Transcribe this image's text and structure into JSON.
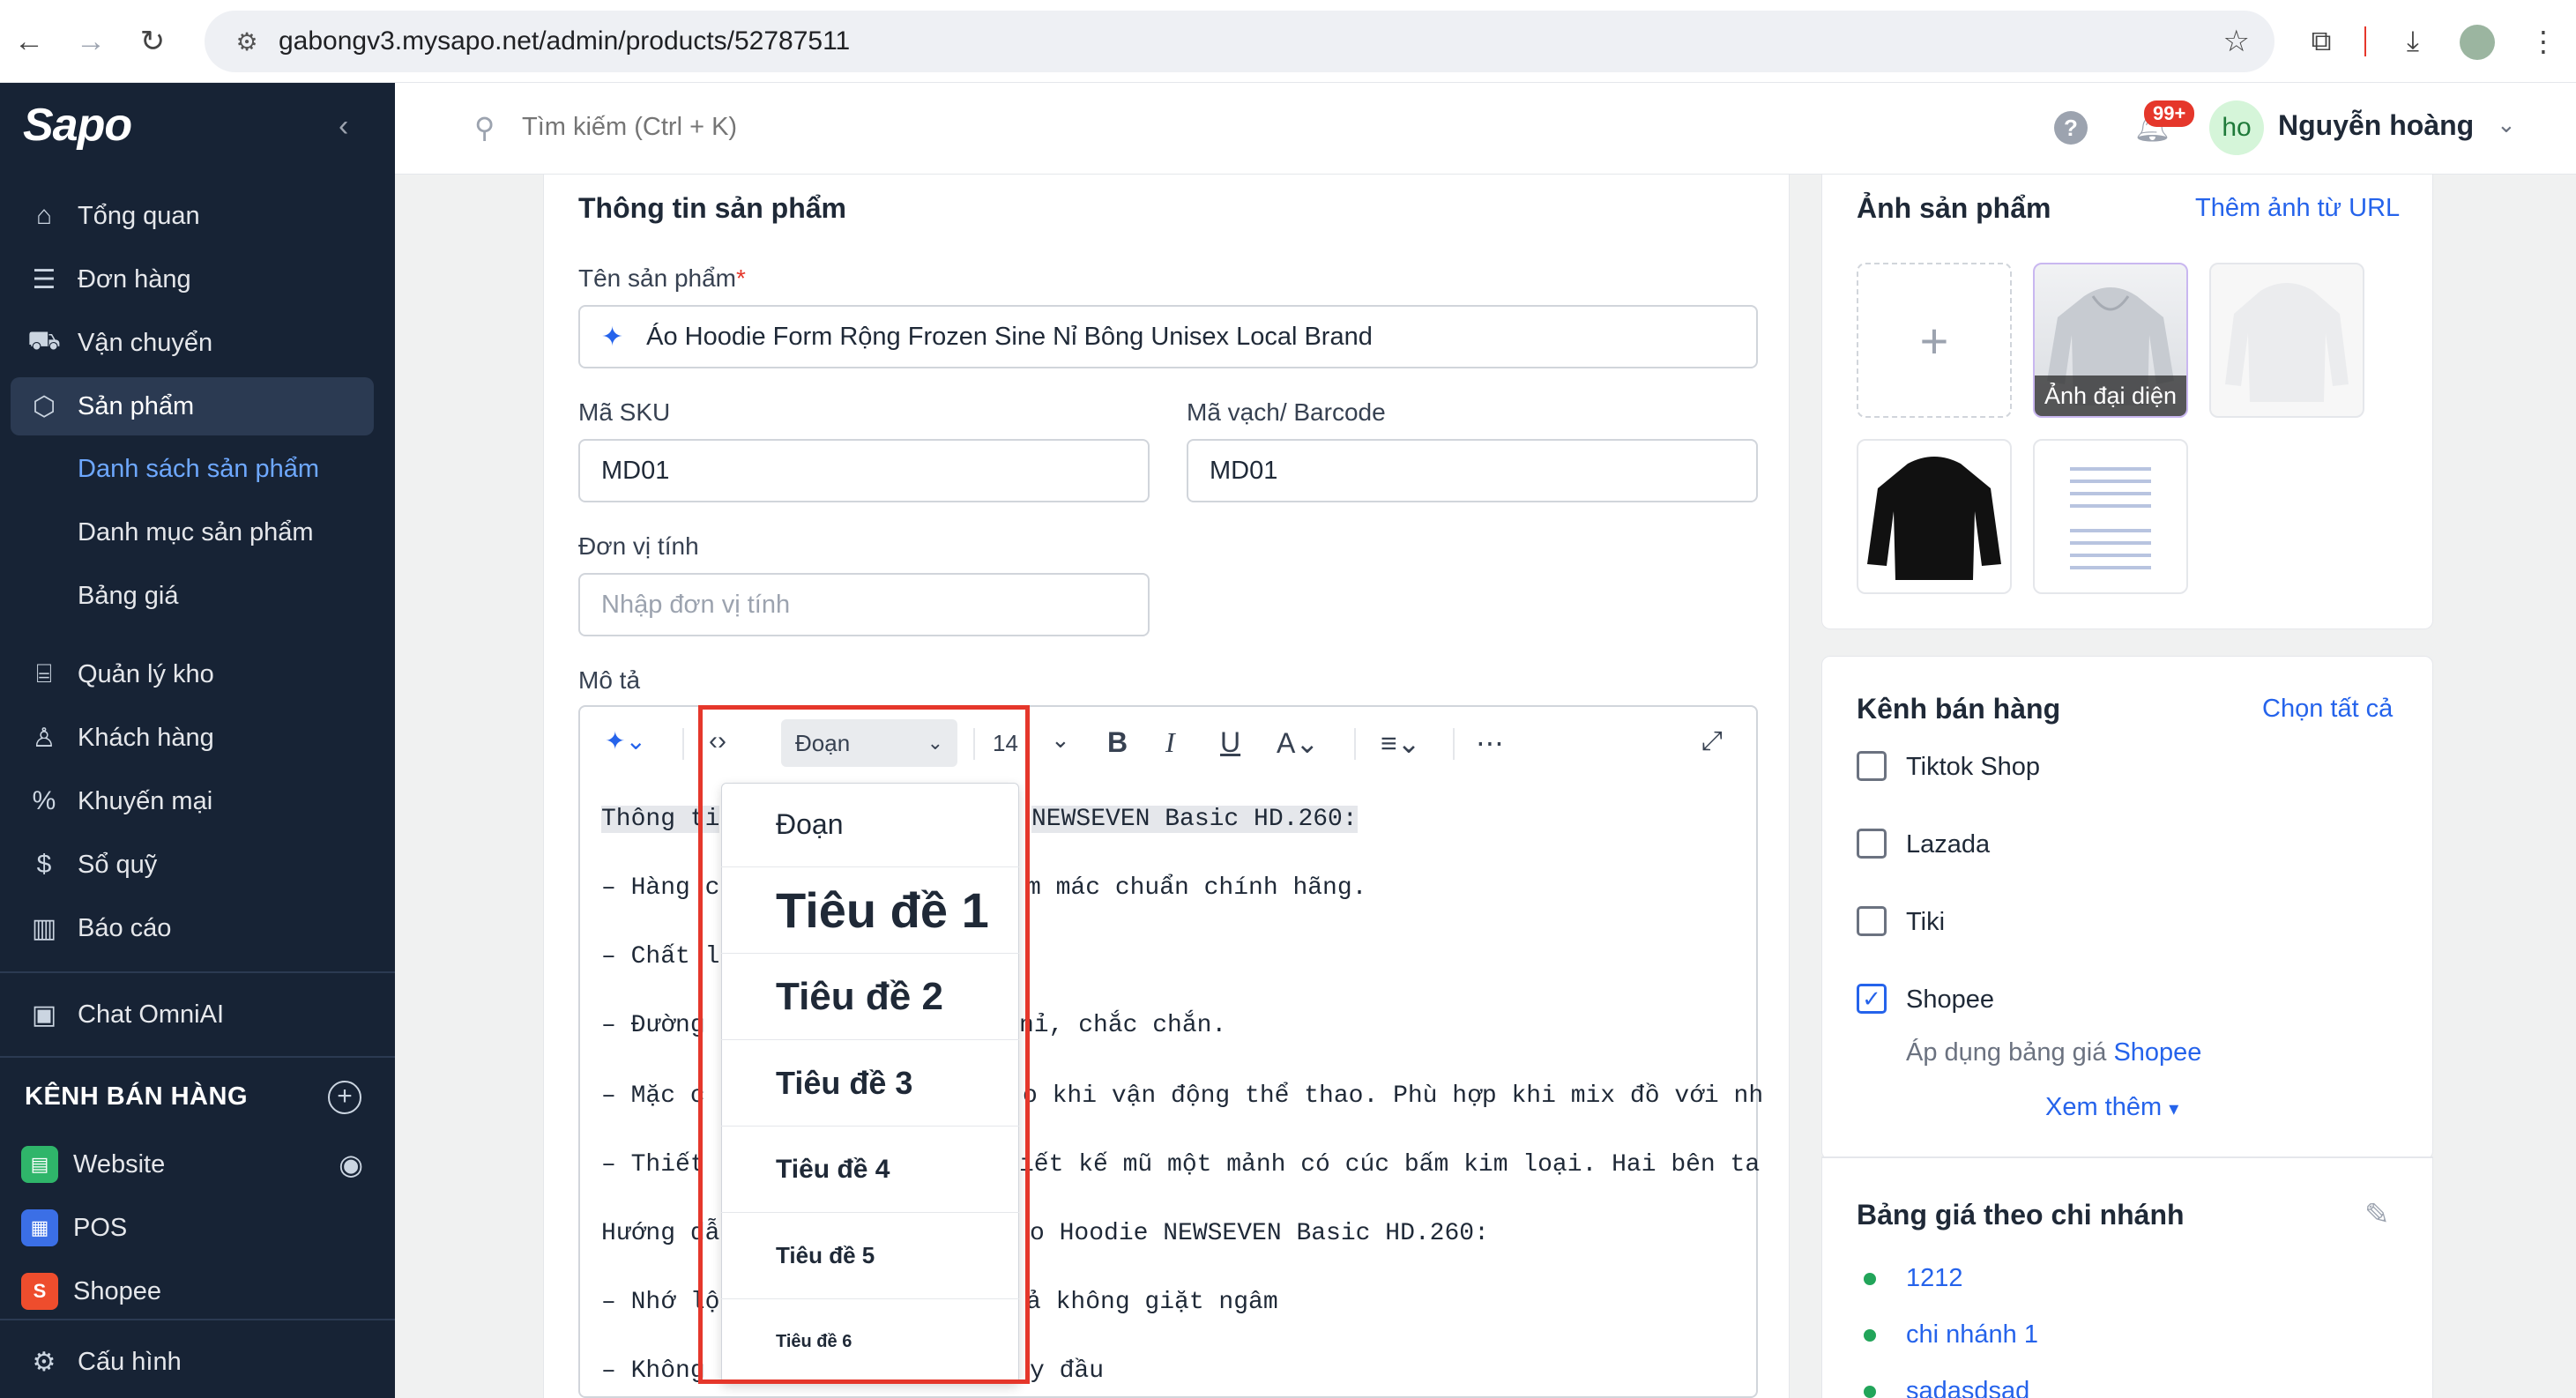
{
  "browser": {
    "url": "gabongv3.mysapo.net/admin/products/52787511"
  },
  "sidebar": {
    "logo": "Sapo",
    "items": [
      {
        "label": "Tổng quan",
        "icon": "home-icon"
      },
      {
        "label": "Đơn hàng",
        "icon": "orders-icon"
      },
      {
        "label": "Vận chuyển",
        "icon": "truck-icon"
      },
      {
        "label": "Sản phẩm",
        "icon": "box-icon"
      },
      {
        "label": "Quản lý kho",
        "icon": "warehouse-icon"
      },
      {
        "label": "Khách hàng",
        "icon": "user-icon"
      },
      {
        "label": "Khuyến mại",
        "icon": "discount-icon"
      },
      {
        "label": "Sổ quỹ",
        "icon": "cashbook-icon"
      },
      {
        "label": "Báo cáo",
        "icon": "chart-icon"
      },
      {
        "label": "Chat OmniAI",
        "icon": "ai-chat-icon"
      }
    ],
    "subitems": [
      "Danh sách sản phẩm",
      "Danh mục sản phẩm",
      "Bảng giá"
    ],
    "channels_header": "KÊNH BÁN HÀNG",
    "channels": [
      {
        "label": "Website",
        "color": "#2fb56a"
      },
      {
        "label": "POS",
        "color": "#3b6fe6"
      },
      {
        "label": "Shopee",
        "color": "#ee4d2d"
      }
    ],
    "settings": "Cấu hình"
  },
  "topbar": {
    "search_placeholder": "Tìm kiếm (Ctrl + K)",
    "badge": "99+",
    "avatar_initials": "ho",
    "user_name": "Nguyễn hoàng"
  },
  "product": {
    "section_title": "Thông tin sản phẩm",
    "name_label": "Tên sản phẩm",
    "name_required": "*",
    "name_value": "Áo Hoodie Form Rộng Frozen Sine Nỉ Bông Unisex Local Brand",
    "sku_label": "Mã SKU",
    "sku_value": "MD01",
    "barcode_label": "Mã vạch/ Barcode",
    "barcode_value": "MD01",
    "unit_label": "Đơn vị tính",
    "unit_placeholder": "Nhập đơn vị tính",
    "desc_label": "Mô tả"
  },
  "editor": {
    "format_selected": "Đoạn",
    "font_size": "14",
    "lines": [
      {
        "left": "Thông ti",
        "right": "NEWSEVEN Basic HD.260:"
      },
      {
        "left": "– Hàng c",
        "right": "m mác chuẩn chính hãng."
      },
      {
        "left": "– Chất l",
        "right": ""
      },
      {
        "left": "– Đường",
        "right": "nỉ, chắc chắn."
      },
      {
        "left": "– Mặc c",
        "right": "o khi vận động thể thao. Phù hợp khi mix đồ với nh"
      },
      {
        "left": "– Thiết",
        "right": "iết kế mũ một mảnh có cúc bấm kim loại. Hai bên ta"
      },
      {
        "left": "Hướng dẫ",
        "right": "o Hoodie NEWSEVEN Basic HD.260:"
      },
      {
        "left": "– Nhớ lộ",
        "right": "ả không giặt ngâm"
      },
      {
        "left": "– Không",
        "right": "y đầu"
      }
    ],
    "dropdown": [
      "Đoạn",
      "Tiêu đề 1",
      "Tiêu đề 2",
      "Tiêu đề 3",
      "Tiêu đề 4",
      "Tiêu đề 5",
      "Tiêu đề 6"
    ]
  },
  "images": {
    "title": "Ảnh sản phẩm",
    "add_url": "Thêm ảnh từ URL",
    "add_symbol": "+",
    "main_label": "Ảnh đại diện"
  },
  "channels": {
    "title": "Kênh bán hàng",
    "select_all": "Chọn tất cả",
    "items": [
      {
        "label": "Tiktok Shop",
        "checked": false
      },
      {
        "label": "Lazada",
        "checked": false
      },
      {
        "label": "Tiki",
        "checked": false
      },
      {
        "label": "Shopee",
        "checked": true
      }
    ],
    "apply_text": "Áp dụng bảng giá",
    "apply_link": "Shopee",
    "more": "Xem thêm"
  },
  "pricebook": {
    "title": "Bảng giá theo chi nhánh",
    "items": [
      "1212",
      "chi nhánh 1",
      "sadasdsad"
    ]
  }
}
